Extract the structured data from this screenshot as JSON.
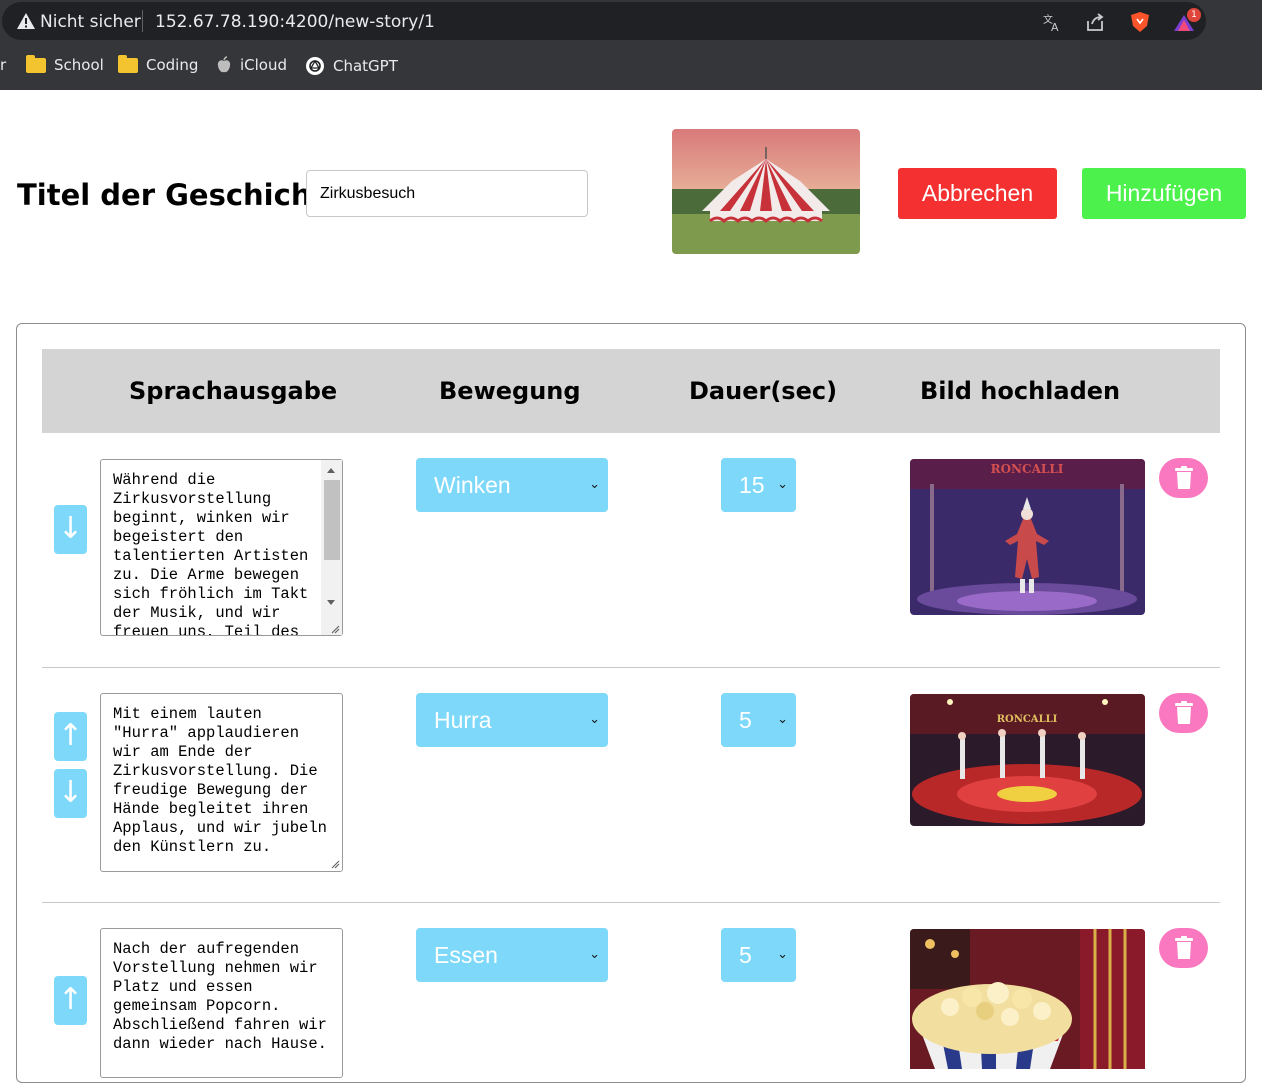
{
  "browser": {
    "security_label": "Nicht sicher",
    "url": "152.67.78.190:4200/new-story/1",
    "brave_badge_count": "1",
    "bookmarks": [
      {
        "label": "r",
        "icon": "none"
      },
      {
        "label": "School",
        "icon": "folder-icon"
      },
      {
        "label": "Coding",
        "icon": "folder-icon"
      },
      {
        "label": "iCloud",
        "icon": "apple-icon"
      },
      {
        "label": "ChatGPT",
        "icon": "chatgpt-icon"
      }
    ]
  },
  "header": {
    "title_label": "Titel der Geschichte",
    "title_value": "Zirkusbesuch",
    "cancel_label": "Abbrechen",
    "add_label": "Hinzufügen"
  },
  "table": {
    "columns": [
      "Sprachausgabe",
      "Bewegung",
      "Dauer(sec)",
      "Bild hochladen"
    ],
    "rows": [
      {
        "speech": "Während die Zirkusvorstellung beginnt, winken wir begeistert den talentierten Artisten zu. Die Arme bewegen sich fröhlich im Takt der Musik, und wir freuen uns, Teil des",
        "movement": "Winken",
        "duration": "15",
        "arrows": [
          "down"
        ]
      },
      {
        "speech": "Mit einem lauten \"Hurra\" applaudieren wir am Ende der Zirkusvorstellung. Die freudige Bewegung der Hände begleitet ihren Applaus, und wir jubeln den Künstlern zu.",
        "movement": "Hurra",
        "duration": "5",
        "arrows": [
          "up",
          "down"
        ]
      },
      {
        "speech": "Nach der aufregenden Vorstellung nehmen wir Platz und essen gemeinsam Popcorn. Abschließend fahren wir dann wieder nach Hause.",
        "movement": "Essen",
        "duration": "5",
        "arrows": [
          "up"
        ]
      }
    ]
  },
  "images": {
    "row1_sign": "RONCALLI",
    "row2_sign": "RONCALLI"
  },
  "colors": {
    "cancel": "#f53030",
    "add": "#4cf14c",
    "select_bg": "#7dd8f9",
    "arrow_bg": "#7dd8f9",
    "trash_bg": "#f978bf",
    "header_bg": "#d4d4d4"
  },
  "arrow_glyphs": {
    "up": "↑",
    "down": "↓"
  }
}
